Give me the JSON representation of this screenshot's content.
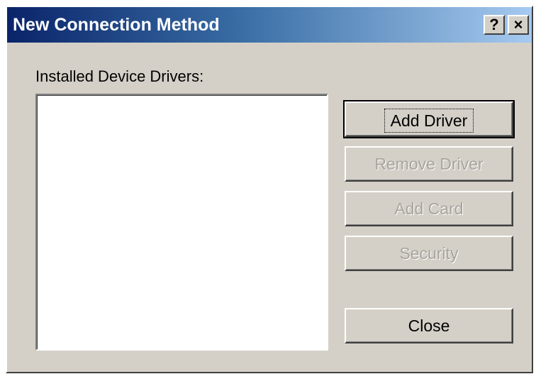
{
  "window": {
    "title": "New Connection Method",
    "help_glyph": "?",
    "close_glyph": "×"
  },
  "drivers": {
    "label": "Installed Device Drivers:",
    "items": []
  },
  "buttons": {
    "add_driver": "Add Driver",
    "remove_driver": "Remove Driver",
    "add_card": "Add Card",
    "security": "Security",
    "close": "Close"
  },
  "colors": {
    "titlebar_start": "#0a246a",
    "titlebar_end": "#a6caf0",
    "face": "#d4d0c8",
    "disabled_text": "#a8a49c"
  }
}
